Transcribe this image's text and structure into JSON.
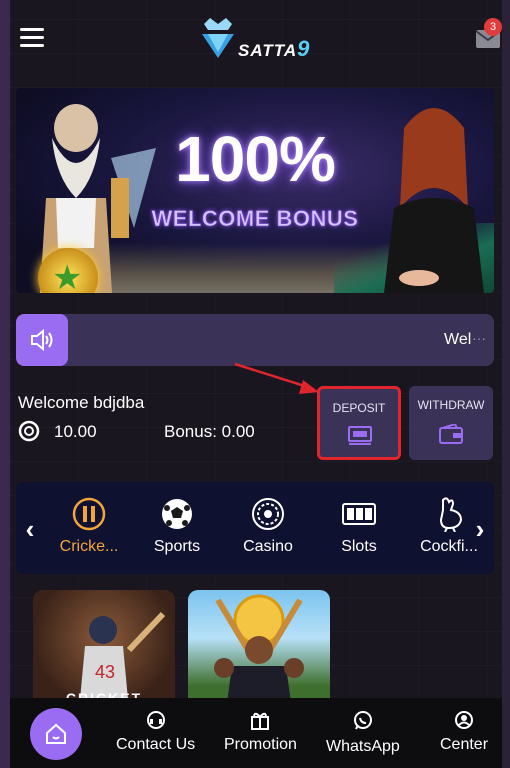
{
  "header": {
    "logo_text": "SATTA",
    "logo_number": "9",
    "mail_badge": "3"
  },
  "banner": {
    "title": "100%",
    "subtitle": "WELCOME BONUS"
  },
  "marquee": {
    "text": "Wel",
    "more": "···"
  },
  "account": {
    "welcome": "Welcome bdjdba",
    "balance": "10.00",
    "bonus": "Bonus: 0.00"
  },
  "actions": {
    "deposit_label": "DEPOSIT",
    "withdraw_label": "WITHDRAW"
  },
  "categories": {
    "left_arrow": "‹",
    "right_arrow": "›",
    "items": [
      {
        "label": "Cricke...",
        "icon": "cricket-icon",
        "active": true
      },
      {
        "label": "Sports",
        "icon": "soccer-ball-icon",
        "active": false
      },
      {
        "label": "Casino",
        "icon": "roulette-icon",
        "active": false
      },
      {
        "label": "Slots",
        "icon": "slot-machine-icon",
        "active": false
      },
      {
        "label": "Cockfi...",
        "icon": "rooster-icon",
        "active": false
      }
    ]
  },
  "tiles": {
    "first_caption": "CRICKET"
  },
  "bottom_nav": {
    "items": [
      {
        "label": "Contact Us",
        "icon": "headset-icon"
      },
      {
        "label": "Promotion",
        "icon": "gift-icon"
      },
      {
        "label": "WhatsApp",
        "icon": "whatsapp-icon"
      },
      {
        "label": "Center",
        "icon": "user-icon"
      }
    ]
  },
  "colors": {
    "accent": "#9a6cf2",
    "highlight": "#f3a53b",
    "panel": "#3b3257",
    "annotation": "#e0262c"
  }
}
